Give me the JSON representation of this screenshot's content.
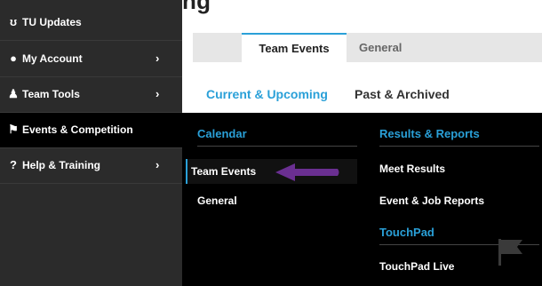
{
  "page": {
    "top_text": "ng",
    "tabs": [
      {
        "label": "Team Events",
        "active": true
      },
      {
        "label": "General",
        "active": false
      }
    ],
    "subtabs": [
      {
        "label": "Current & Upcoming",
        "active": true
      },
      {
        "label": "Past & Archived",
        "active": false
      }
    ]
  },
  "sidebar": {
    "items": [
      {
        "icon": "tu-updates-icon",
        "glyph": "ʊ",
        "label": "TU Updates",
        "chevron": ""
      },
      {
        "icon": "account-icon",
        "glyph": "●",
        "label": "My Account",
        "chevron": "›"
      },
      {
        "icon": "team-icon",
        "glyph": "♟",
        "label": "Team Tools",
        "chevron": "›"
      },
      {
        "icon": "flag-icon",
        "glyph": "⚑",
        "label": "Events & Competition",
        "chevron": ""
      },
      {
        "icon": "help-icon",
        "glyph": "?",
        "label": "Help & Training",
        "chevron": "›"
      }
    ]
  },
  "mega_menu": {
    "left_column": {
      "heading": "Calendar",
      "links": [
        "Team Events",
        "General"
      ]
    },
    "right_column": {
      "heading": "Results & Reports",
      "links": [
        "Meet Results",
        "Event & Job Reports"
      ],
      "heading2": "TouchPad",
      "links2": [
        "TouchPad Live"
      ]
    }
  },
  "colors": {
    "accent": "#2aa0d8",
    "sidebar_bg": "#2b2b2b",
    "menu_bg": "#000000",
    "arrow": "#6a2f91"
  }
}
